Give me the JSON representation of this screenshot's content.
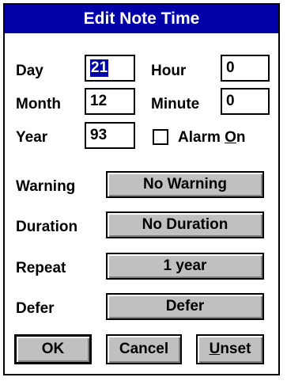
{
  "window": {
    "title": "Edit Note Time"
  },
  "fields": {
    "day_label": "Day",
    "day_value": "21",
    "hour_label": "Hour",
    "hour_value": "0",
    "month_label": "Month",
    "month_value": "12",
    "minute_label": "Minute",
    "minute_value": "0",
    "year_label": "Year",
    "year_value": "93"
  },
  "alarm": {
    "label_prefix": "Alarm ",
    "label_accel": "O",
    "label_suffix": "n",
    "checked": false
  },
  "options": {
    "warning_label": "Warning",
    "warning_value": "No Warning",
    "duration_label": "Duration",
    "duration_value": "No Duration",
    "repeat_label": "Repeat",
    "repeat_value": "1 year",
    "defer_label": "Defer",
    "defer_value": "Defer"
  },
  "buttons": {
    "ok": "OK",
    "cancel": "Cancel",
    "unset_accel": "U",
    "unset_rest": "nset"
  }
}
